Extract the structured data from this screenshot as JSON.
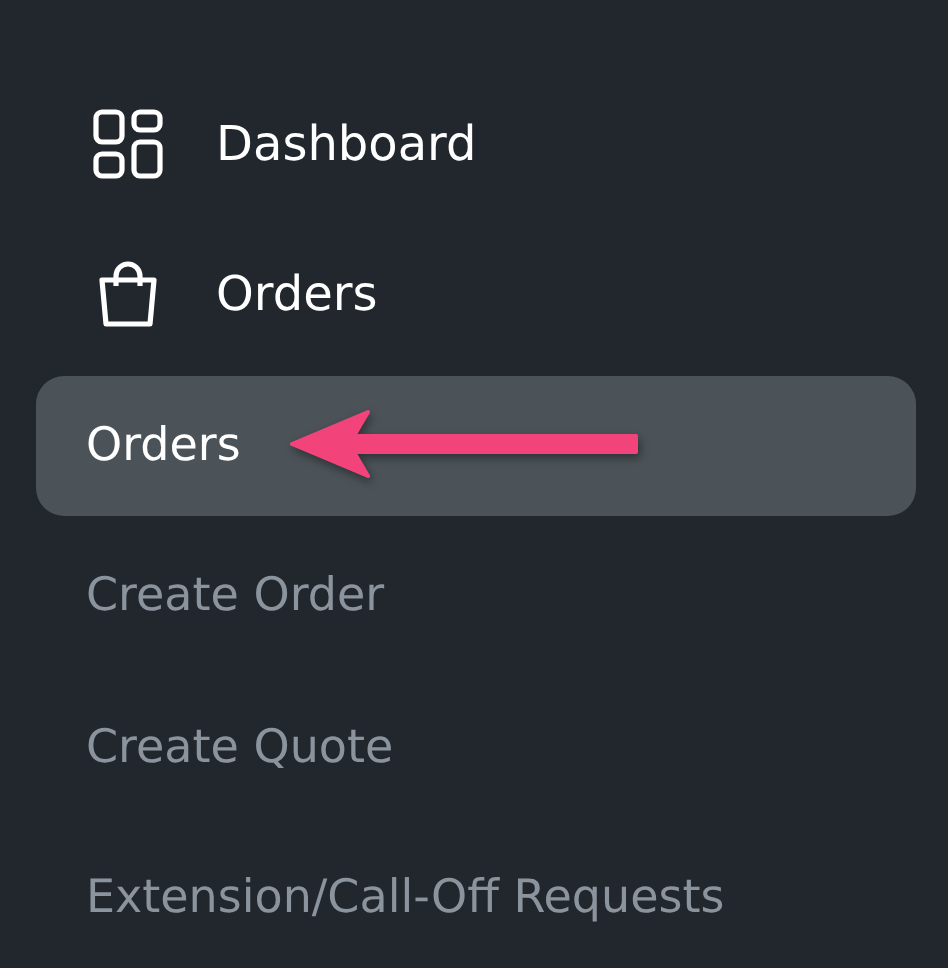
{
  "nav": [
    {
      "label": "Dashboard"
    },
    {
      "label": "Orders"
    }
  ],
  "subnav": [
    {
      "label": "Orders",
      "selected": true
    },
    {
      "label": "Create Order",
      "selected": false
    },
    {
      "label": "Create Quote",
      "selected": false
    },
    {
      "label": "Extension/Call-Off Requests",
      "selected": false
    }
  ]
}
